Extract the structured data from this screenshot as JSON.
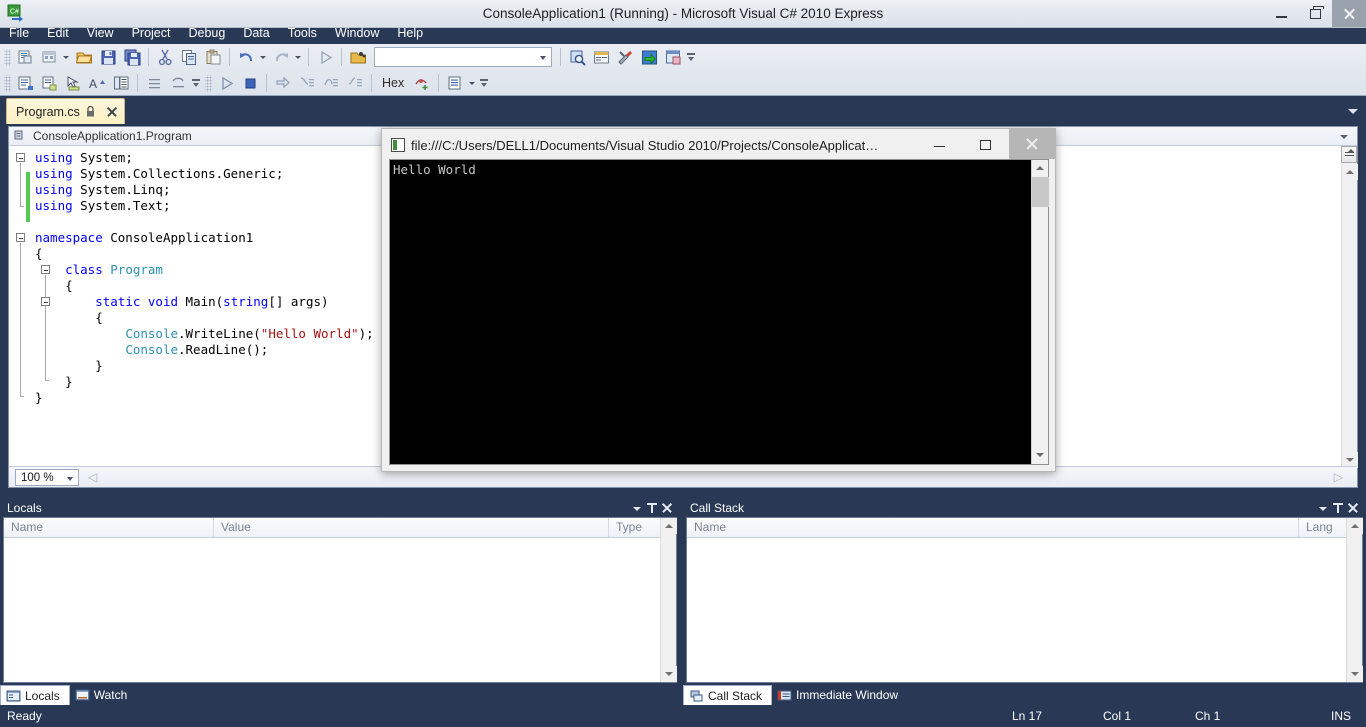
{
  "window": {
    "title": "ConsoleApplication1 (Running) - Microsoft Visual C# 2010 Express",
    "app_icon": "csharp-icon",
    "minimize_label": "Minimize",
    "maximize_label": "Maximize",
    "close_label": "Close"
  },
  "menu": {
    "items": [
      {
        "label": "File"
      },
      {
        "label": "Edit"
      },
      {
        "label": "View"
      },
      {
        "label": "Project"
      },
      {
        "label": "Debug"
      },
      {
        "label": "Data"
      },
      {
        "label": "Tools"
      },
      {
        "label": "Window"
      },
      {
        "label": "Help"
      }
    ]
  },
  "toolbar": {
    "row1": [
      {
        "name": "new-project-button",
        "icon": "new-project-icon"
      },
      {
        "name": "add-new-item-button",
        "icon": "add-item-icon"
      },
      {
        "name": "add-item-dropdown",
        "icon": "chevron-down-icon"
      },
      {
        "name": "open-file-button",
        "icon": "open-folder-icon"
      },
      {
        "name": "save-button",
        "icon": "save-icon"
      },
      {
        "name": "save-all-button",
        "icon": "save-all-icon"
      },
      {
        "name": "cut-button",
        "icon": "scissors-icon"
      },
      {
        "name": "copy-button",
        "icon": "copy-icon"
      },
      {
        "name": "paste-button",
        "icon": "paste-icon"
      },
      {
        "name": "undo-button",
        "icon": "undo-icon"
      },
      {
        "name": "undo-dropdown",
        "icon": "chevron-down-icon"
      },
      {
        "name": "redo-button",
        "icon": "redo-icon"
      },
      {
        "name": "redo-dropdown",
        "icon": "chevron-down-icon"
      },
      {
        "name": "start-debugging-button",
        "icon": "play-icon"
      },
      {
        "name": "solution-configurations-button",
        "icon": "config-icon"
      }
    ],
    "find_combo_value": "",
    "find_combo_placeholder": "",
    "row1_right": [
      {
        "name": "find-in-files-button",
        "icon": "find-in-files-icon"
      },
      {
        "name": "properties-window-button",
        "icon": "properties-icon"
      },
      {
        "name": "toolbox-button",
        "icon": "tools-icon"
      },
      {
        "name": "object-browser-button",
        "icon": "object-browser-icon"
      },
      {
        "name": "start-page-button",
        "icon": "start-page-icon"
      }
    ],
    "row2": [
      {
        "name": "comment-selection-button",
        "icon": "comment-icon"
      },
      {
        "name": "uncomment-selection-button",
        "icon": "uncomment-icon"
      },
      {
        "name": "quick-find-button",
        "icon": "quickfind-icon"
      },
      {
        "name": "increase-font-button",
        "icon": "font-size-icon"
      },
      {
        "name": "toggle-outlining-button",
        "icon": "outlining-icon"
      },
      {
        "name": "decrease-indent-button",
        "icon": "decrease-indent-icon"
      },
      {
        "name": "undo-last-button",
        "icon": "undo-small-icon"
      }
    ],
    "row2b": [
      {
        "name": "continue-button",
        "icon": "play-icon"
      },
      {
        "name": "stop-debugging-button",
        "icon": "stop-icon"
      },
      {
        "name": "show-next-statement-button",
        "icon": "next-statement-icon"
      },
      {
        "name": "step-into-button",
        "icon": "step-into-icon"
      },
      {
        "name": "step-over-button",
        "icon": "step-over-icon"
      },
      {
        "name": "step-out-button",
        "icon": "step-out-icon"
      }
    ],
    "hex_label": "Hex",
    "row2c": [
      {
        "name": "breakpoints-button",
        "icon": "breakpoint-icon"
      },
      {
        "name": "debug-windows-button",
        "icon": "debug-windows-icon"
      },
      {
        "name": "debug-windows-dropdown",
        "icon": "chevron-down-icon"
      }
    ]
  },
  "document_tab": {
    "name": "Program.cs",
    "lock_icon": "lock-icon",
    "close_icon": "close-icon"
  },
  "editor": {
    "navbar_context": "ConsoleApplication1.Program",
    "navbar_icon": "class-members-icon",
    "zoom_level": "100 %",
    "code_lines": [
      {
        "indent": 0,
        "fold": "open",
        "tokens": [
          {
            "t": "using",
            "c": "kw"
          },
          {
            "t": " System;",
            "c": ""
          }
        ]
      },
      {
        "indent": 0,
        "fold": "",
        "tokens": [
          {
            "t": "using",
            "c": "kw"
          },
          {
            "t": " System.Collections.Generic;",
            "c": ""
          }
        ]
      },
      {
        "indent": 0,
        "fold": "",
        "tokens": [
          {
            "t": "using",
            "c": "kw"
          },
          {
            "t": " System.Linq;",
            "c": ""
          }
        ]
      },
      {
        "indent": 0,
        "fold": "",
        "tokens": [
          {
            "t": "using",
            "c": "kw"
          },
          {
            "t": " System.Text;",
            "c": ""
          }
        ]
      },
      {
        "indent": 0,
        "fold": "",
        "tokens": []
      },
      {
        "indent": 0,
        "fold": "open",
        "tokens": [
          {
            "t": "namespace",
            "c": "kw"
          },
          {
            "t": " ConsoleApplication1",
            "c": ""
          }
        ]
      },
      {
        "indent": 0,
        "fold": "",
        "tokens": [
          {
            "t": "{",
            "c": ""
          }
        ]
      },
      {
        "indent": 4,
        "fold": "open",
        "tokens": [
          {
            "t": "class",
            "c": "kw"
          },
          {
            "t": " ",
            "c": ""
          },
          {
            "t": "Program",
            "c": "typ"
          }
        ]
      },
      {
        "indent": 4,
        "fold": "",
        "tokens": [
          {
            "t": "{",
            "c": ""
          }
        ]
      },
      {
        "indent": 8,
        "fold": "open",
        "tokens": [
          {
            "t": "static",
            "c": "kw"
          },
          {
            "t": " ",
            "c": ""
          },
          {
            "t": "void",
            "c": "kw"
          },
          {
            "t": " Main(",
            "c": ""
          },
          {
            "t": "string",
            "c": "kw"
          },
          {
            "t": "[] args)",
            "c": ""
          }
        ]
      },
      {
        "indent": 8,
        "fold": "",
        "tokens": [
          {
            "t": "{",
            "c": ""
          }
        ]
      },
      {
        "indent": 12,
        "fold": "",
        "tokens": [
          {
            "t": "Console",
            "c": "typ"
          },
          {
            "t": ".WriteLine(",
            "c": ""
          },
          {
            "t": "\"Hello World\"",
            "c": "str"
          },
          {
            "t": ");",
            "c": ""
          }
        ]
      },
      {
        "indent": 12,
        "fold": "",
        "tokens": [
          {
            "t": "Console",
            "c": "typ"
          },
          {
            "t": ".ReadLine();",
            "c": ""
          }
        ]
      },
      {
        "indent": 8,
        "fold": "",
        "tokens": [
          {
            "t": "}",
            "c": ""
          }
        ]
      },
      {
        "indent": 4,
        "fold": "",
        "tokens": [
          {
            "t": "}",
            "c": ""
          }
        ]
      },
      {
        "indent": 0,
        "fold": "",
        "tokens": [
          {
            "t": "}",
            "c": ""
          }
        ]
      }
    ]
  },
  "console_window": {
    "title": "file:///C:/Users/DELL1/Documents/Visual Studio 2010/Projects/ConsoleApplicat…",
    "icon": "console-icon",
    "output": "Hello World",
    "minimize_label": "Minimize",
    "maximize_label": "Maximize",
    "close_label": "Close"
  },
  "locals_panel": {
    "title": "Locals",
    "columns": [
      "Name",
      "Value",
      "Type"
    ],
    "rows": [],
    "tabs": [
      {
        "label": "Locals",
        "icon": "locals-icon",
        "active": true
      },
      {
        "label": "Watch",
        "icon": "watch-icon",
        "active": false
      }
    ]
  },
  "callstack_panel": {
    "title": "Call Stack",
    "columns": [
      "Name",
      "Lang"
    ],
    "rows": [],
    "tabs": [
      {
        "label": "Call Stack",
        "icon": "callstack-icon",
        "active": true
      },
      {
        "label": "Immediate Window",
        "icon": "immediate-icon",
        "active": false
      }
    ]
  },
  "statusbar": {
    "ready": "Ready",
    "line": "Ln 17",
    "column": "Col 1",
    "character": "Ch 1",
    "insert_mode": "INS"
  },
  "colors": {
    "chrome": "#293955",
    "keyword": "#0000FF",
    "type": "#2B91AF",
    "string": "#A31515",
    "tab_active": "#FDF1C4",
    "changebar": "#54C954"
  }
}
